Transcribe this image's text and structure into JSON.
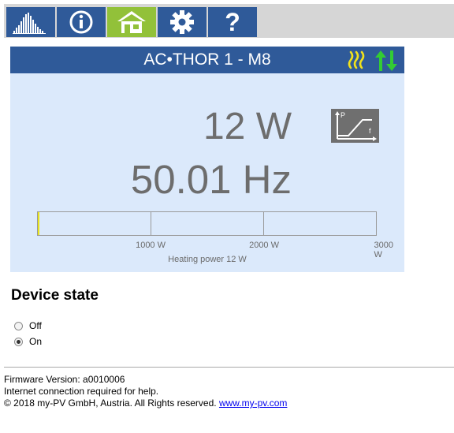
{
  "nav": {
    "tabs": [
      {
        "name": "chart-icon",
        "active": false
      },
      {
        "name": "info-icon",
        "active": false
      },
      {
        "name": "home-icon",
        "active": true
      },
      {
        "name": "gear-icon",
        "active": false
      },
      {
        "name": "help-icon",
        "active": false
      }
    ],
    "help_glyph": "?"
  },
  "device": {
    "title": "AC•THOR 1 - M8",
    "heating_icon": "heat-waves-icon",
    "connection_icon": "up-down-arrows-icon",
    "power": "12 W",
    "frequency": "50.01 Hz",
    "mode_icon": "power-frequency-ramp-icon",
    "mode_icon_labels": {
      "p": "P",
      "f": "f"
    },
    "power_bar": {
      "value_w": 12,
      "max_w": 3000,
      "ticks": [
        "1000 W",
        "2000 W",
        "3000 W"
      ],
      "label": "Heating power 12 W"
    },
    "colors": {
      "header": "#2f5a99",
      "active_tab": "#92c139",
      "panel": "#dbe9fb",
      "heat_icon": "#f2e21b",
      "arrows_icon": "#33cc33",
      "bar_fill": "#e8e31a"
    }
  },
  "device_state": {
    "title": "Device state",
    "options": [
      {
        "label": "Off",
        "checked": false
      },
      {
        "label": "On",
        "checked": true
      }
    ]
  },
  "footer": {
    "firmware": "Firmware Version: a0010006",
    "help_note": "Internet connection required for help.",
    "copyright": "© 2018 my-PV GmbH, Austria. All Rights reserved.",
    "link_text": "www.my-pv.com"
  }
}
